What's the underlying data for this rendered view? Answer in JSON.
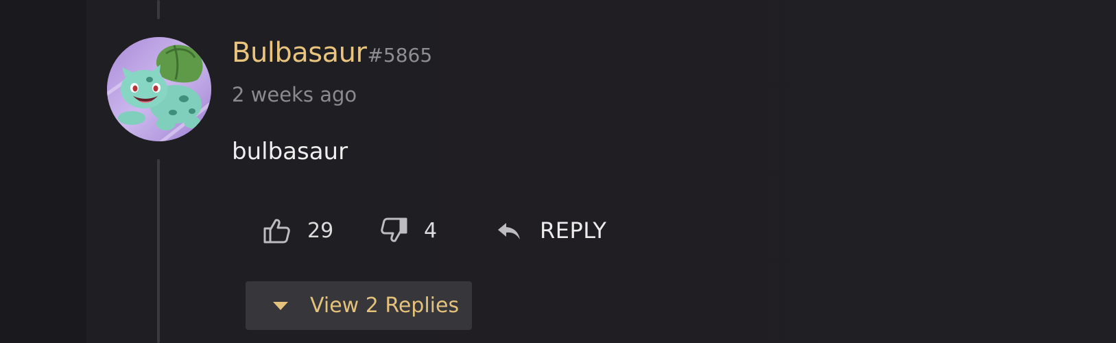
{
  "comment": {
    "username": "Bulbasaur",
    "discriminator": "#5865",
    "timestamp": "2 weeks ago",
    "text": "bulbasaur",
    "avatar_icon": "bulbasaur-avatar-icon",
    "likes": "29",
    "dislikes": "4",
    "reply_label": "REPLY",
    "view_replies_label": "View 2 Replies"
  },
  "icons": {
    "like": "thumbs-up-icon",
    "dislike": "thumbs-down-icon",
    "reply": "reply-arrow-icon",
    "expand": "caret-down-icon"
  },
  "colors": {
    "background": "#201f23",
    "username": "#e8c47e",
    "accent": "#e4c27c",
    "muted_text": "#8b8a8f",
    "button_bg": "#37363a"
  }
}
